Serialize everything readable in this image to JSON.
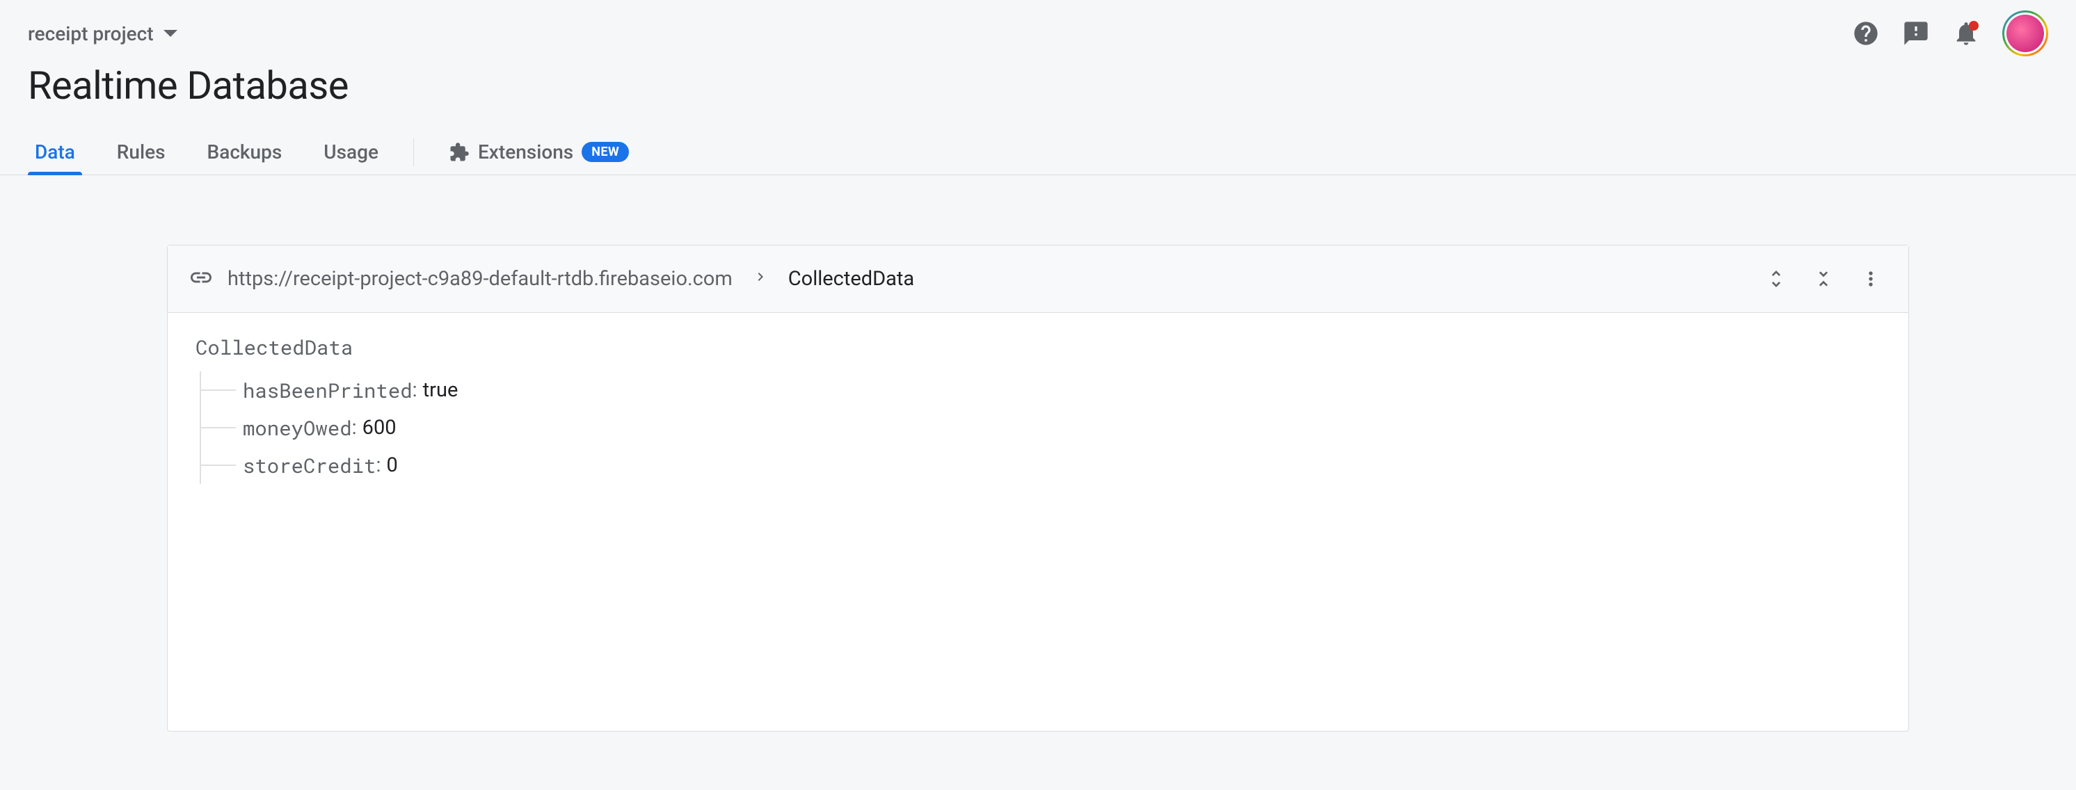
{
  "header": {
    "project_name": "receipt project"
  },
  "page_title": "Realtime Database",
  "tabs": {
    "t0": "Data",
    "t1": "Rules",
    "t2": "Backups",
    "t3": "Usage",
    "ext_label": "Extensions",
    "ext_badge": "NEW"
  },
  "toolbar": {
    "url": "https://receipt-project-c9a89-default-rtdb.firebaseio.com",
    "current_path": "CollectedData"
  },
  "tree": {
    "root": "CollectedData",
    "row0": {
      "key": "hasBeenPrinted",
      "value": "true"
    },
    "row1": {
      "key": "moneyOwed",
      "value": "600"
    },
    "row2": {
      "key": "storeCredit",
      "value": "0"
    }
  }
}
